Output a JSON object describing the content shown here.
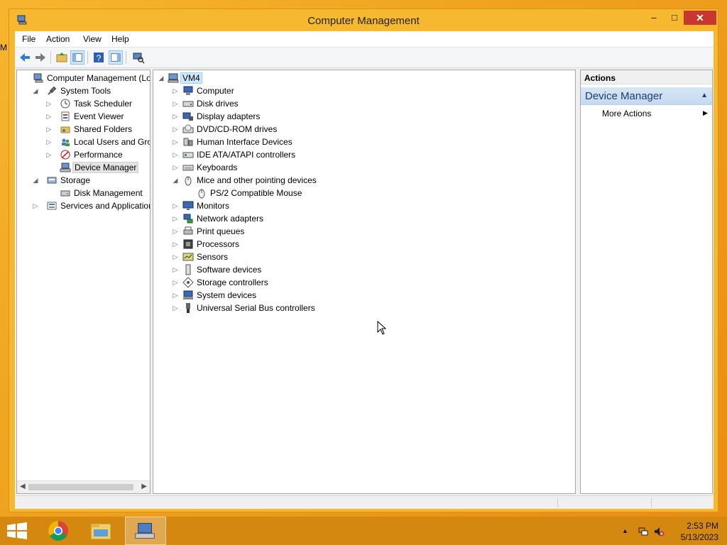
{
  "desktop": {
    "edge_label": "M"
  },
  "window": {
    "title": "Computer Management",
    "controls": {
      "minimize": "–",
      "maximize": "□",
      "close": "✕"
    }
  },
  "menu": [
    "File",
    "Action",
    "View",
    "Help"
  ],
  "toolbar": {
    "icons": [
      "back-arrow-icon",
      "forward-arrow-icon",
      "up-folder-icon",
      "show-hide-console-tree-icon",
      "help-icon",
      "show-hide-action-pane-icon",
      "scan-hardware-icon"
    ]
  },
  "left_tree": {
    "items": [
      {
        "label": "Computer Management (Local",
        "level": 0,
        "expander": "",
        "icon": "computer-management-icon"
      },
      {
        "label": "System Tools",
        "level": 1,
        "expander": "◢",
        "icon": "tools-icon"
      },
      {
        "label": "Task Scheduler",
        "level": 2,
        "expander": "▷",
        "icon": "clock-icon"
      },
      {
        "label": "Event Viewer",
        "level": 2,
        "expander": "▷",
        "icon": "event-viewer-icon"
      },
      {
        "label": "Shared Folders",
        "level": 2,
        "expander": "▷",
        "icon": "shared-folder-icon"
      },
      {
        "label": "Local Users and Groups",
        "level": 2,
        "expander": "▷",
        "icon": "users-icon"
      },
      {
        "label": "Performance",
        "level": 2,
        "expander": "▷",
        "icon": "performance-icon"
      },
      {
        "label": "Device Manager",
        "level": 2,
        "expander": "",
        "icon": "device-manager-icon",
        "selected": true
      },
      {
        "label": "Storage",
        "level": 1,
        "expander": "◢",
        "icon": "storage-icon"
      },
      {
        "label": "Disk Management",
        "level": 2,
        "expander": "",
        "icon": "disk-icon"
      },
      {
        "label": "Services and Applications",
        "level": 1,
        "expander": "▷",
        "icon": "services-icon"
      }
    ]
  },
  "device_tree": {
    "root": "VM4",
    "items": [
      {
        "label": "Computer",
        "expander": "▷",
        "icon": "computer-icon"
      },
      {
        "label": "Disk drives",
        "expander": "▷",
        "icon": "disk-drive-icon"
      },
      {
        "label": "Display adapters",
        "expander": "▷",
        "icon": "display-adapter-icon"
      },
      {
        "label": "DVD/CD-ROM drives",
        "expander": "▷",
        "icon": "dvd-drive-icon"
      },
      {
        "label": "Human Interface Devices",
        "expander": "▷",
        "icon": "hid-icon"
      },
      {
        "label": "IDE ATA/ATAPI controllers",
        "expander": "▷",
        "icon": "ide-controller-icon"
      },
      {
        "label": "Keyboards",
        "expander": "▷",
        "icon": "keyboard-icon"
      },
      {
        "label": "Mice and other pointing devices",
        "expander": "◢",
        "icon": "mouse-icon"
      },
      {
        "label": "PS/2 Compatible Mouse",
        "expander": "",
        "icon": "mouse-icon",
        "child": true
      },
      {
        "label": "Monitors",
        "expander": "▷",
        "icon": "monitor-icon"
      },
      {
        "label": "Network adapters",
        "expander": "▷",
        "icon": "network-adapter-icon"
      },
      {
        "label": "Print queues",
        "expander": "▷",
        "icon": "printer-icon"
      },
      {
        "label": "Processors",
        "expander": "▷",
        "icon": "processor-icon"
      },
      {
        "label": "Sensors",
        "expander": "▷",
        "icon": "sensor-icon"
      },
      {
        "label": "Software devices",
        "expander": "▷",
        "icon": "software-device-icon"
      },
      {
        "label": "Storage controllers",
        "expander": "▷",
        "icon": "storage-controller-icon"
      },
      {
        "label": "System devices",
        "expander": "▷",
        "icon": "system-device-icon"
      },
      {
        "label": "Universal Serial Bus controllers",
        "expander": "▷",
        "icon": "usb-icon"
      }
    ]
  },
  "actions": {
    "header": "Actions",
    "section": "Device Manager",
    "items": [
      "More Actions"
    ]
  },
  "taskbar": {
    "apps": [
      "start-button-icon",
      "chrome-icon",
      "file-explorer-icon",
      "computer-management-taskbar-icon"
    ],
    "time": "2:53 PM",
    "date": "5/13/2023"
  },
  "colors": {
    "titlebar": "#f5b82e",
    "close": "#c7372f",
    "selection": "#cde8ff",
    "taskbar": "#d4880f"
  }
}
